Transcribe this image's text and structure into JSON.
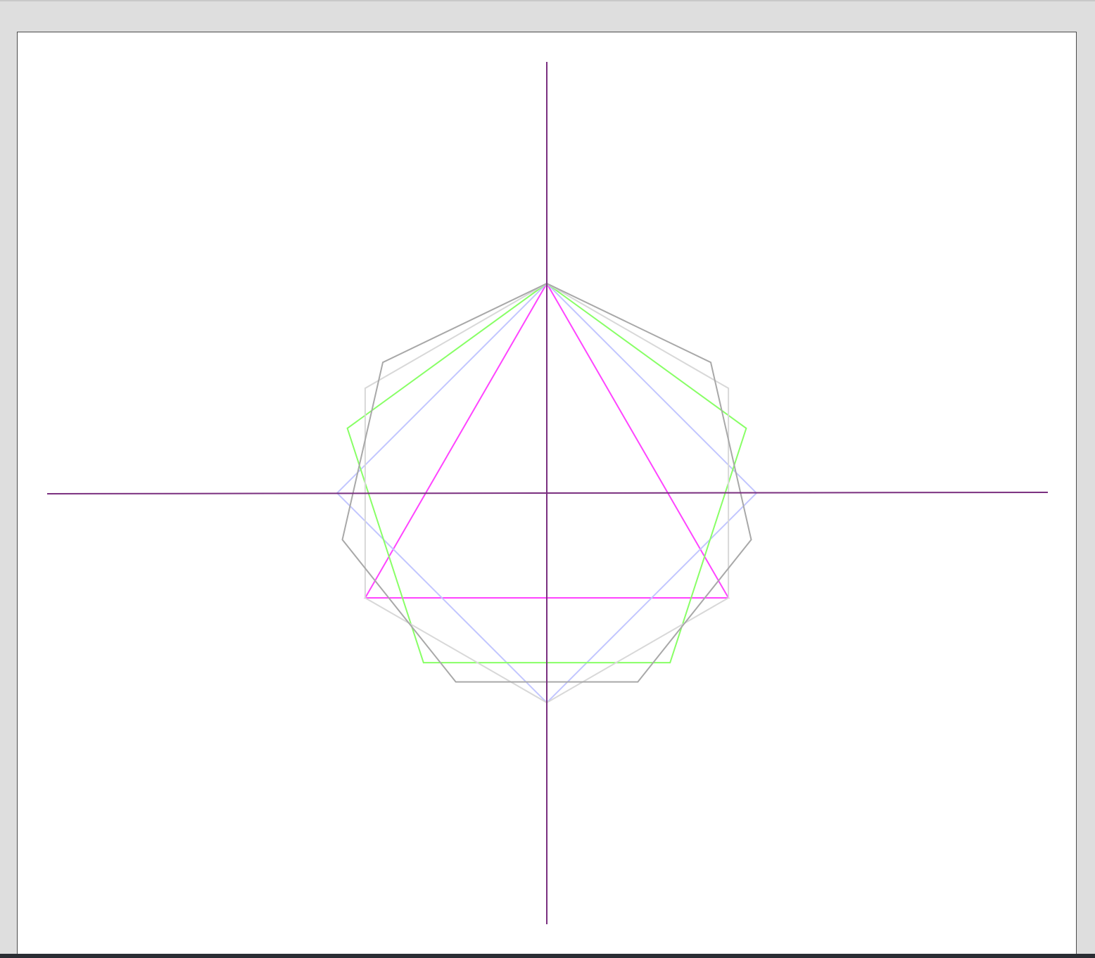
{
  "canvas": {
    "background": "#ffffff",
    "border_color": "#4a4a4a"
  },
  "window": {
    "background": "#dedede",
    "bottom_bar_color": "#2a2d33"
  },
  "axes": {
    "color": "#7a2f7f"
  },
  "polygons": [
    {
      "name": "triangle",
      "sides": 3,
      "color": "#ff44ff"
    },
    {
      "name": "square",
      "sides": 4,
      "color": "#c2c6ff"
    },
    {
      "name": "pentagon",
      "sides": 5,
      "color": "#88ff66"
    },
    {
      "name": "hexagon",
      "sides": 6,
      "color": "#d8d8d8"
    },
    {
      "name": "heptagon",
      "sides": 7,
      "color": "#a8a8a8"
    }
  ]
}
